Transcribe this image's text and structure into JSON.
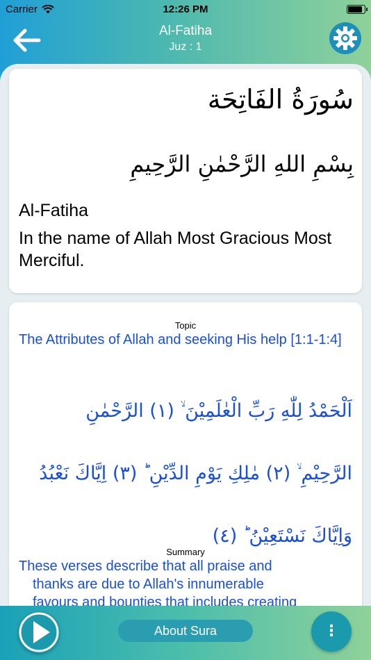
{
  "status_bar": {
    "carrier": "Carrier",
    "time": "12:26 PM"
  },
  "nav": {
    "title": "Al-Fatiha",
    "subtitle": "Juz : 1"
  },
  "header_card": {
    "arabic_title": "سُورَةُ الفَاتِحَة",
    "bismillah": "بِسْمِ اللهِ الرَّحْمٰنِ الرَّحِيمِ",
    "sura_name": "Al-Fatiha",
    "translation": "In the name of Allah Most Gracious Most Merciful."
  },
  "detail_card": {
    "topic_label": "Topic",
    "topic_text": "The Attributes of Allah and seeking His help [1:1-1:4]",
    "ayah_lines": [
      "اَلْحَمْدُ لِلّٰهِ رَبِّ الْعٰلَمِيْنَ ۙ (١) الرَّحْمٰنِ",
      "الرَّحِيْمِ ۙ (٢) مٰلِكِ يَوْمِ الدِّيْنِ ؕ (٣) اِيَّاكَ نَعْبُدُ",
      "وَاِيَّاكَ نَسْتَعِيْنُ ؕ (٤)"
    ],
    "summary_label": "Summary",
    "summary_line1": "These verses describe that all praise and",
    "summary_line2": "thanks are due to Allah's innumerable",
    "summary_line3": "favours and bounties that includes creating"
  },
  "bottom_bar": {
    "about_label": "About Sura",
    "more_label": "⋮"
  }
}
